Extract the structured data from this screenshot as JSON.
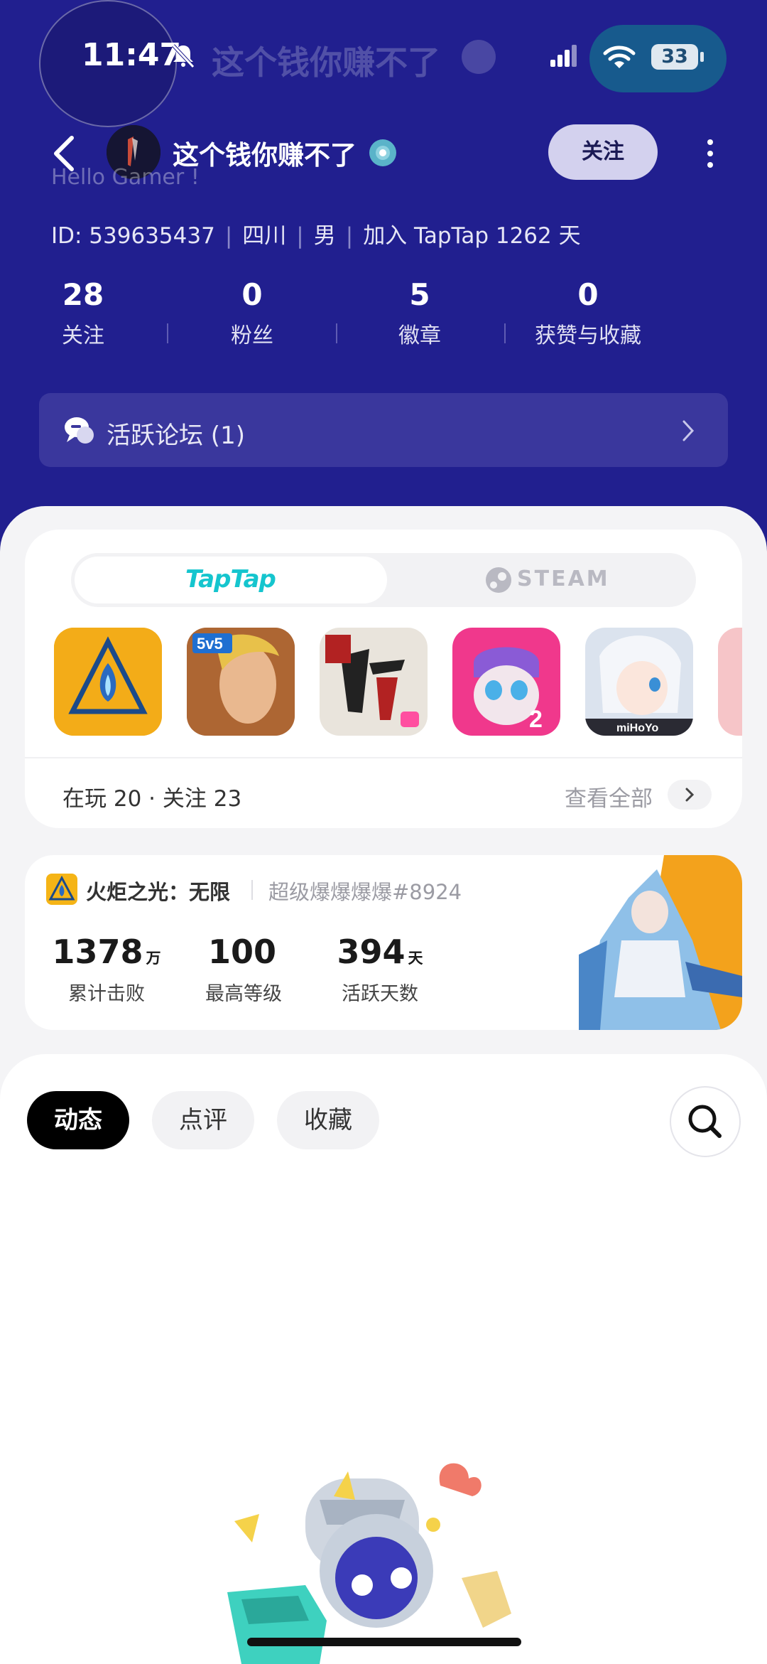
{
  "status_bar": {
    "time": "11:47",
    "battery": "33",
    "ghost_title": "这个钱你赚不了"
  },
  "nav": {
    "username": "这个钱你赚不了",
    "follow_label": "关注",
    "hello_text": "Hello Gamer !"
  },
  "profile": {
    "id_text": "ID: 539635437",
    "region": "四川",
    "gender": "男",
    "joined": "加入 TapTap 1262 天",
    "stats": [
      {
        "num": "28",
        "label": "关注"
      },
      {
        "num": "0",
        "label": "粉丝"
      },
      {
        "num": "5",
        "label": "徽章"
      },
      {
        "num": "0",
        "label": "获赞与收藏"
      }
    ],
    "forum_label": "活跃论坛 (1)"
  },
  "games": {
    "tabs": [
      {
        "label": "TapTap",
        "active": true
      },
      {
        "label": "STEAM",
        "active": false
      }
    ],
    "icons": [
      "torchlight-icon",
      "honor-of-kings-icon",
      "card-game-icon",
      "talking-angela-icon",
      "honkai-icon"
    ],
    "playing_text": "在玩 20 · 关注 23",
    "view_all": "查看全部"
  },
  "record": {
    "game_name": "火炬之光：无限",
    "player_tag": "超级爆爆爆爆#8924",
    "stats": [
      {
        "num": "1378",
        "unit": "万",
        "label": "累计击败"
      },
      {
        "num": "100",
        "unit": "",
        "label": "最高等级"
      },
      {
        "num": "394",
        "unit": "天",
        "label": "活跃天数"
      }
    ]
  },
  "feed_tabs": [
    {
      "label": "动态",
      "active": true
    },
    {
      "label": "点评",
      "active": false
    },
    {
      "label": "收藏",
      "active": false
    }
  ],
  "colors": {
    "header_bg": "#211f8f",
    "accent_taptap": "#15c5ce",
    "status_pill": "#175a8d"
  }
}
